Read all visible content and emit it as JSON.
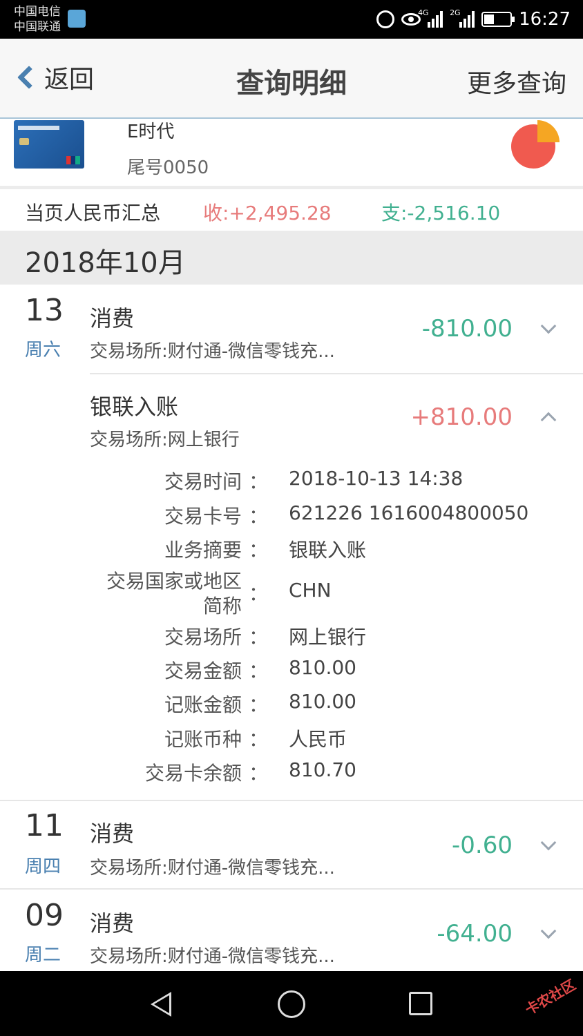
{
  "status_bar": {
    "carrier_1": "中国电信",
    "carrier_2": "中国联通",
    "sig_1_label": "4G",
    "sig_2_label": "2G",
    "time": "16:27",
    "battery_level": 0.4
  },
  "nav": {
    "back_label": "返回",
    "title": "查询明细",
    "more_label": "更多查询"
  },
  "card": {
    "name": "E时代",
    "tail": "尾号0050",
    "pie_colors": [
      "#f05a4f",
      "#f5a623"
    ]
  },
  "summary": {
    "label": "当页人民币汇总",
    "income": "收:+2,495.28",
    "expense": "支:-2,516.10"
  },
  "month": "2018年10月",
  "transactions": [
    {
      "day": "13",
      "weekday": "周六",
      "type": "消费",
      "place": "交易场所:财付通-微信零钱充...",
      "amount": "-810.00",
      "direction": "out",
      "expanded": false
    },
    {
      "day": "",
      "weekday": "",
      "type": "银联入账",
      "place": "交易场所:网上银行",
      "amount": "+810.00",
      "direction": "in",
      "expanded": true
    },
    {
      "day": "11",
      "weekday": "周四",
      "type": "消费",
      "place": "交易场所:财付通-微信零钱充...",
      "amount": "-0.60",
      "direction": "out",
      "expanded": false
    },
    {
      "day": "09",
      "weekday": "周二",
      "type": "消费",
      "place": "交易场所:财付通-微信零钱充...",
      "amount": "-64.00",
      "direction": "out",
      "expanded": false
    }
  ],
  "detail": {
    "colon": "：",
    "rows": [
      {
        "label": "交易时间",
        "value": "2018-10-13 14:38"
      },
      {
        "label": "交易卡号",
        "value": "621226 1616004800050"
      },
      {
        "label": "业务摘要",
        "value": "银联入账"
      },
      {
        "label_line1": "交易国家或地区",
        "label_line2": "简称",
        "value": "CHN"
      },
      {
        "label": "交易场所",
        "value": "网上银行"
      },
      {
        "label": "交易金额",
        "value": "810.00"
      },
      {
        "label": "记账金额",
        "value": "810.00"
      },
      {
        "label": "记账币种",
        "value": "人民币"
      },
      {
        "label": "交易卡余额",
        "value": "810.70"
      }
    ]
  },
  "colors": {
    "income": "#e77b7b",
    "expense": "#41b090",
    "accent": "#4a80b0"
  },
  "watermark": "卡农社区"
}
